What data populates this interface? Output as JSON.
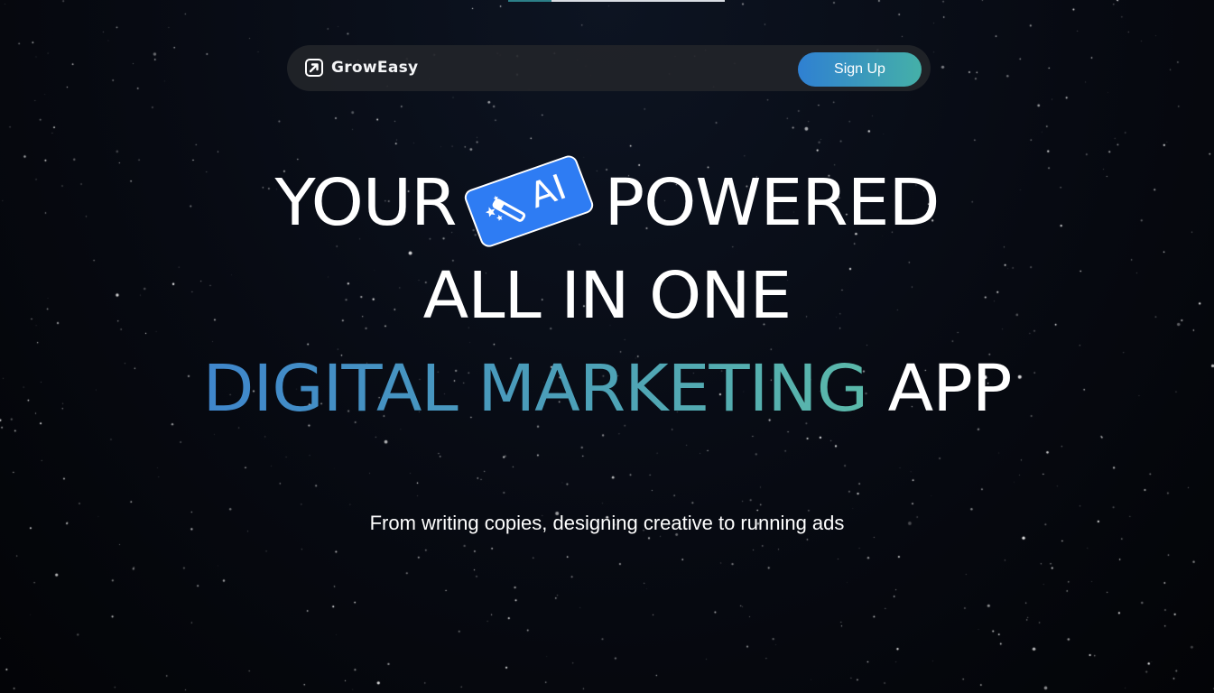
{
  "navbar": {
    "brand_name": "GrowEasy",
    "brand_icon": "arrow-up-right-icon",
    "signup_label": "Sign Up"
  },
  "hero": {
    "line1_part1": "YOUR",
    "badge_text": "AI",
    "badge_icon": "magic-wand-icon",
    "line1_part2": "POWERED",
    "line2": "ALL IN ONE",
    "line3_highlight": "DIGITAL MARKETING",
    "line3_rest": "APP",
    "subtitle": "From writing copies, designing creative to running ads"
  },
  "colors": {
    "background": "#05070d",
    "navbar_bg": "#222429",
    "signup_gradient_start": "#2f80d2",
    "signup_gradient_end": "#45b0a8",
    "badge_blue": "#2e7cf3",
    "highlight_gradient_start": "#3f86cc",
    "highlight_gradient_end": "#5bb9aa",
    "text": "#ffffff"
  }
}
